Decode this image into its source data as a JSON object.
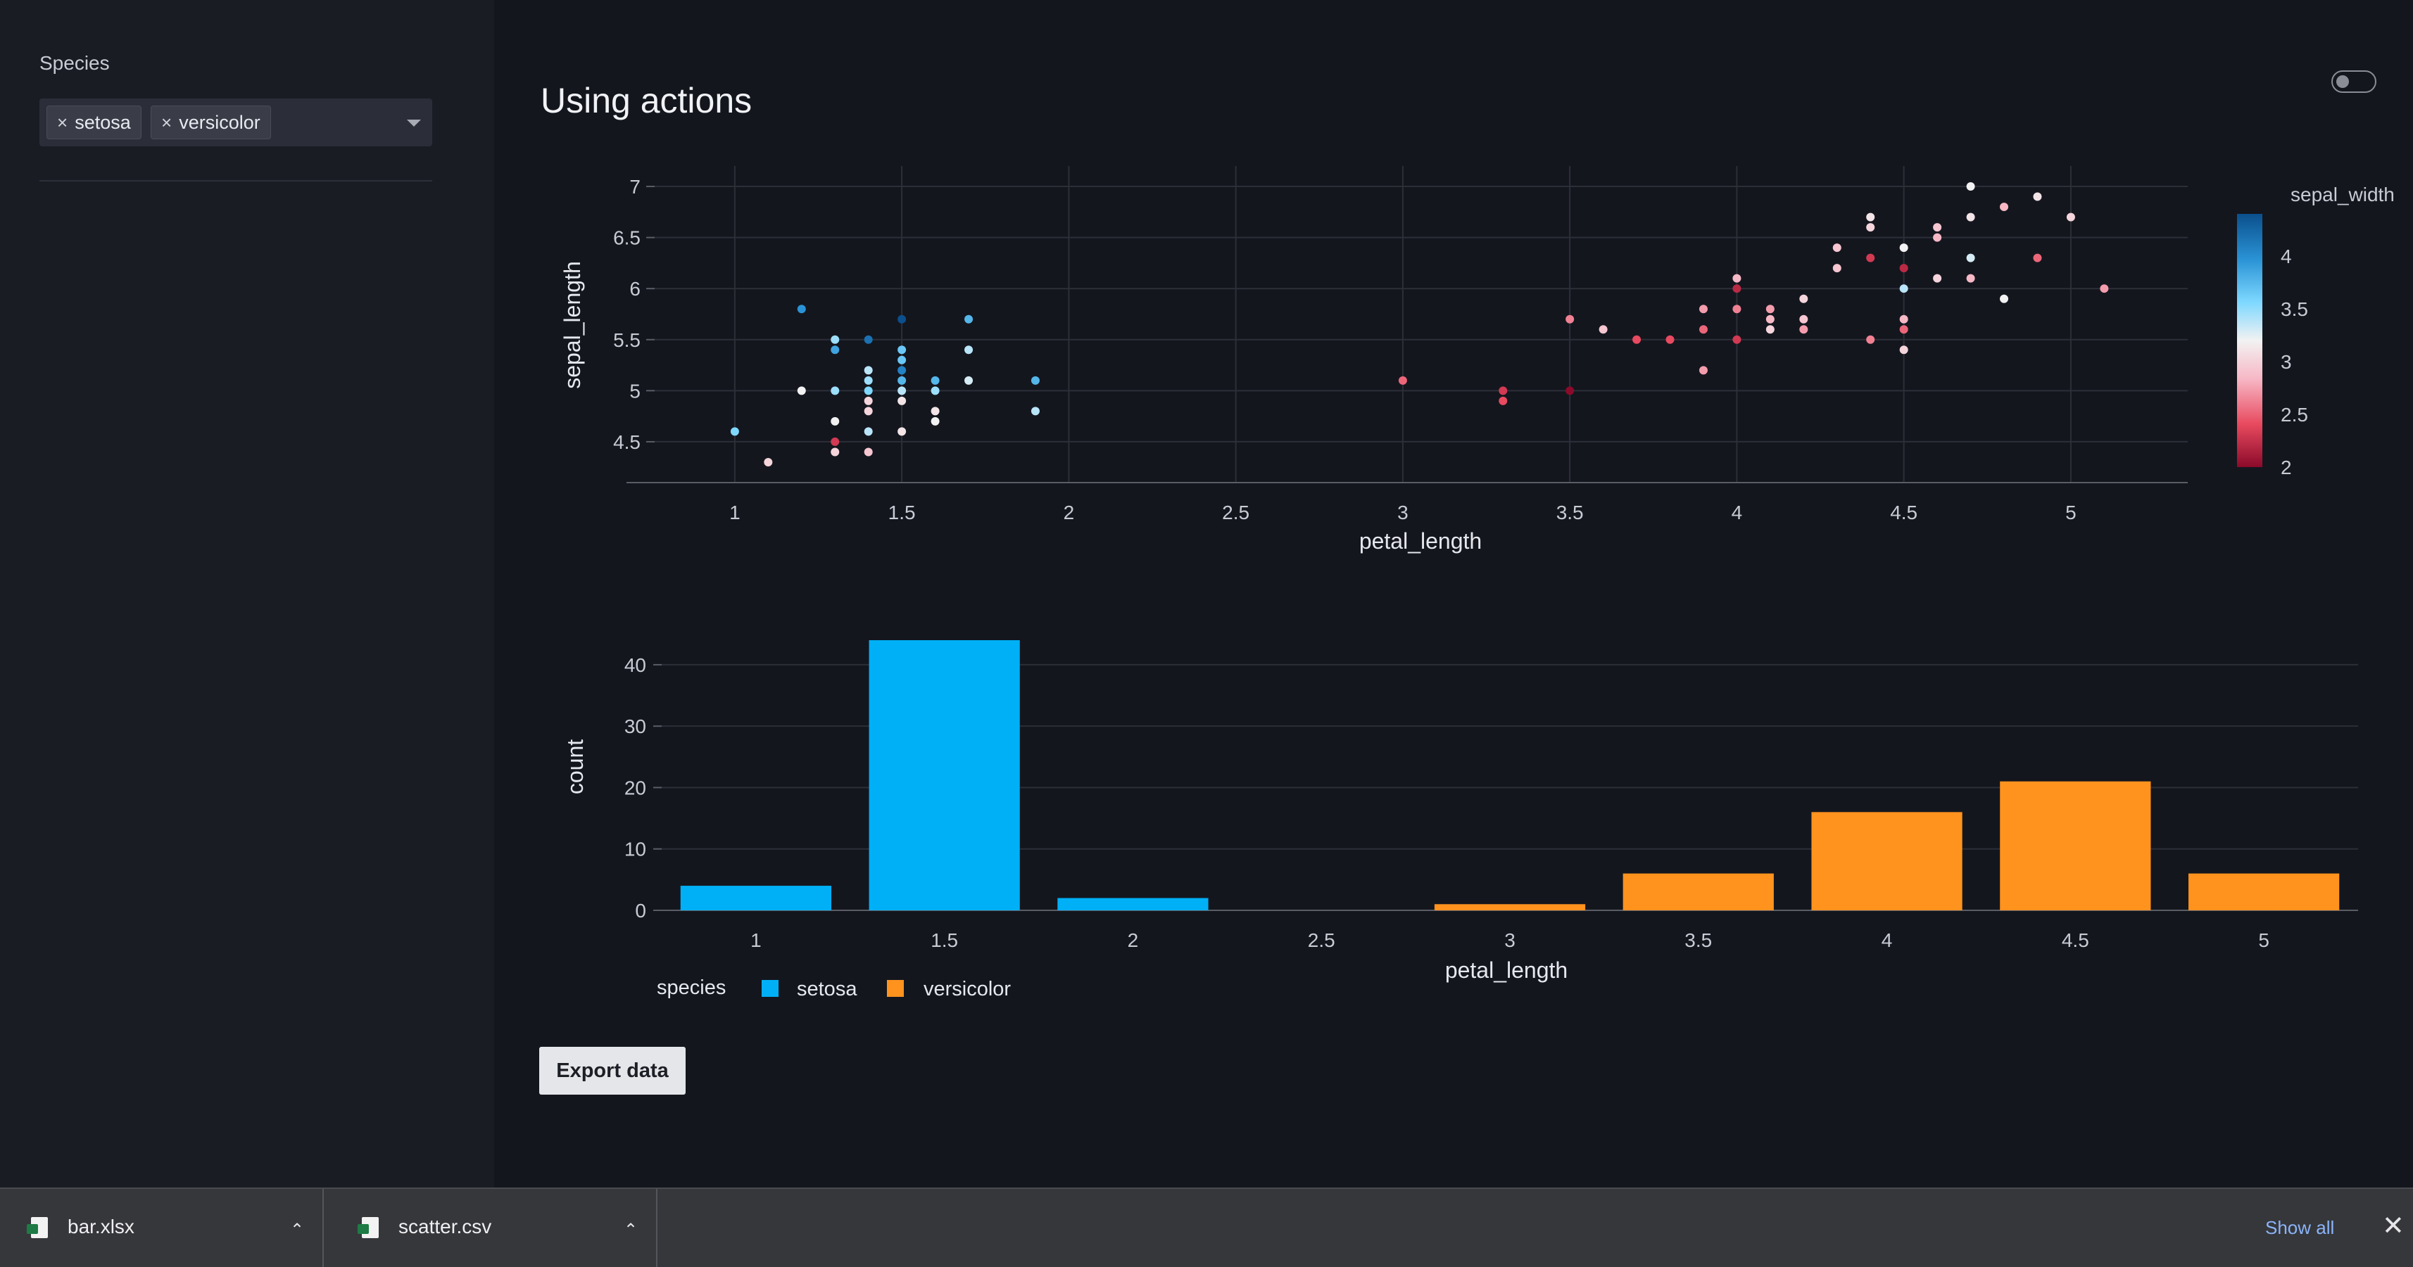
{
  "sidebar": {
    "filter_label": "Species",
    "chips": [
      {
        "remove_glyph": "×",
        "label": "setosa"
      },
      {
        "remove_glyph": "×",
        "label": "versicolor"
      }
    ]
  },
  "main": {
    "title": "Using actions",
    "export_button_label": "Export data"
  },
  "scatter_chart": {
    "type": "scatter",
    "xlabel": "petal_length",
    "ylabel": "sepal_length",
    "xlim": [
      0.76,
      5.35
    ],
    "ylim": [
      4.1,
      7.2
    ],
    "x_ticks": [
      "1",
      "1.5",
      "2",
      "2.5",
      "3",
      "3.5",
      "4",
      "4.5",
      "5"
    ],
    "y_ticks": [
      "4.5",
      "5",
      "5.5",
      "6",
      "6.5",
      "7"
    ],
    "colorbar": {
      "title": "sepal_width",
      "ticks": [
        "2",
        "2.5",
        "3",
        "3.5",
        "4"
      ],
      "range": [
        2.0,
        4.4
      ],
      "colors": [
        "#8b0a2a",
        "#e84a5f",
        "#f7b8c6",
        "#f2f2f2",
        "#7fd8ff",
        "#2a93d5",
        "#0b4f8c"
      ]
    },
    "points": [
      [
        1.0,
        4.6,
        3.6
      ],
      [
        1.1,
        4.3,
        3.0
      ],
      [
        1.2,
        5.8,
        4.0
      ],
      [
        1.2,
        5.0,
        3.2
      ],
      [
        1.3,
        5.5,
        3.5
      ],
      [
        1.3,
        5.4,
        3.9
      ],
      [
        1.3,
        5.0,
        3.5
      ],
      [
        1.3,
        4.7,
        3.2
      ],
      [
        1.3,
        4.5,
        2.3
      ],
      [
        1.3,
        4.4,
        3.0
      ],
      [
        1.4,
        5.5,
        4.2
      ],
      [
        1.4,
        5.2,
        3.4
      ],
      [
        1.4,
        5.1,
        3.5
      ],
      [
        1.4,
        5.0,
        3.6
      ],
      [
        1.4,
        4.9,
        3.0
      ],
      [
        1.4,
        4.8,
        3.0
      ],
      [
        1.4,
        4.6,
        3.4
      ],
      [
        1.4,
        4.4,
        2.9
      ],
      [
        1.5,
        5.7,
        4.4
      ],
      [
        1.5,
        5.4,
        3.7
      ],
      [
        1.5,
        5.3,
        3.7
      ],
      [
        1.5,
        5.2,
        4.1
      ],
      [
        1.5,
        5.1,
        3.8
      ],
      [
        1.5,
        5.0,
        3.4
      ],
      [
        1.5,
        4.9,
        3.1
      ],
      [
        1.5,
        4.6,
        3.1
      ],
      [
        1.6,
        5.1,
        3.8
      ],
      [
        1.6,
        5.0,
        3.5
      ],
      [
        1.6,
        4.8,
        3.1
      ],
      [
        1.6,
        4.7,
        3.2
      ],
      [
        1.7,
        5.7,
        3.8
      ],
      [
        1.7,
        5.4,
        3.4
      ],
      [
        1.7,
        5.1,
        3.3
      ],
      [
        1.9,
        5.1,
        3.8
      ],
      [
        1.9,
        4.8,
        3.4
      ],
      [
        3.0,
        5.1,
        2.5
      ],
      [
        3.3,
        5.0,
        2.3
      ],
      [
        3.3,
        4.9,
        2.4
      ],
      [
        3.5,
        5.7,
        2.6
      ],
      [
        3.5,
        5.0,
        2.0
      ],
      [
        3.6,
        5.6,
        2.9
      ],
      [
        3.7,
        5.5,
        2.4
      ],
      [
        3.8,
        5.5,
        2.4
      ],
      [
        3.9,
        5.8,
        2.7
      ],
      [
        3.9,
        5.6,
        2.5
      ],
      [
        3.9,
        5.2,
        2.7
      ],
      [
        4.0,
        6.1,
        2.8
      ],
      [
        4.0,
        6.0,
        2.2
      ],
      [
        4.0,
        5.8,
        2.6
      ],
      [
        4.0,
        5.5,
        2.3
      ],
      [
        4.1,
        5.8,
        2.7
      ],
      [
        4.1,
        5.7,
        2.8
      ],
      [
        4.1,
        5.6,
        3.0
      ],
      [
        4.2,
        5.9,
        3.0
      ],
      [
        4.2,
        5.7,
        2.9
      ],
      [
        4.2,
        5.6,
        2.7
      ],
      [
        4.3,
        6.4,
        2.9
      ],
      [
        4.3,
        6.2,
        2.9
      ],
      [
        4.4,
        6.7,
        3.1
      ],
      [
        4.4,
        6.6,
        3.0
      ],
      [
        4.4,
        6.3,
        2.3
      ],
      [
        4.4,
        5.5,
        2.6
      ],
      [
        4.5,
        6.4,
        3.2
      ],
      [
        4.5,
        6.2,
        2.2
      ],
      [
        4.5,
        6.0,
        3.4
      ],
      [
        4.5,
        5.7,
        2.8
      ],
      [
        4.5,
        5.6,
        2.5
      ],
      [
        4.5,
        5.4,
        3.0
      ],
      [
        4.6,
        6.6,
        2.9
      ],
      [
        4.6,
        6.5,
        2.8
      ],
      [
        4.6,
        6.1,
        3.0
      ],
      [
        4.7,
        7.0,
        3.2
      ],
      [
        4.7,
        6.7,
        3.1
      ],
      [
        4.7,
        6.3,
        3.3
      ],
      [
        4.7,
        6.1,
        2.8
      ],
      [
        4.8,
        6.8,
        2.8
      ],
      [
        4.8,
        5.9,
        3.2
      ],
      [
        4.9,
        6.9,
        3.1
      ],
      [
        4.9,
        6.3,
        2.5
      ],
      [
        5.0,
        6.7,
        3.0
      ],
      [
        5.1,
        6.0,
        2.7
      ]
    ]
  },
  "bar_chart": {
    "type": "bar",
    "xlabel": "petal_length",
    "ylabel": "count",
    "xlim": [
      0.75,
      5.25
    ],
    "ylim": [
      0,
      44
    ],
    "x_ticks": [
      "1",
      "1.5",
      "2",
      "2.5",
      "3",
      "3.5",
      "4",
      "4.5",
      "5"
    ],
    "y_ticks": [
      "0",
      "10",
      "20",
      "30",
      "40"
    ],
    "bin_width": 0.5,
    "legend_title": "species",
    "series": [
      {
        "name": "setosa",
        "color": "#00b0f6",
        "bins": [
          1.0,
          1.5,
          2.0
        ],
        "values": [
          4,
          44,
          2
        ]
      },
      {
        "name": "versicolor",
        "color": "#ff931e",
        "bins": [
          3.0,
          3.5,
          4.0,
          4.5,
          5.0
        ],
        "values": [
          1,
          6,
          16,
          21,
          6
        ]
      }
    ]
  },
  "downloads": {
    "items": [
      {
        "filename": "bar.xlsx"
      },
      {
        "filename": "scatter.csv"
      }
    ],
    "show_all_label": "Show all",
    "chevron_glyph": "⌃",
    "close_glyph": "✕"
  }
}
